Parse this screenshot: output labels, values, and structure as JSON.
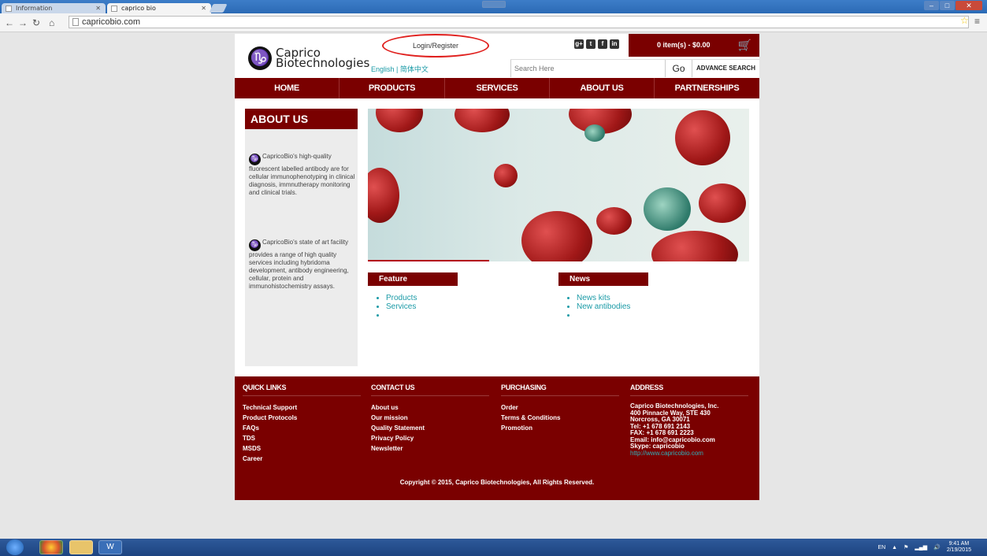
{
  "browser": {
    "tabs": [
      {
        "label": "Information",
        "active": false
      },
      {
        "label": "caprico bio",
        "active": true
      }
    ],
    "url": "capricobio.com"
  },
  "site": {
    "logo": {
      "line1": "Caprico",
      "line2": "Biotechnologies"
    },
    "login": "Login/Register",
    "language": "English | 简体中文",
    "social_icons": [
      "google-plus-icon",
      "twitter-icon",
      "facebook-icon",
      "linkedin-icon"
    ],
    "cart": "0 item(s) - $0.00",
    "search": {
      "placeholder": "Search Here",
      "go": "Go",
      "advanced": "ADVANCE SEARCH"
    },
    "nav": [
      "HOME",
      "PRODUCTS",
      "SERVICES",
      "ABOUT US",
      "PARTNERSHIPS"
    ],
    "about": {
      "title": "ABOUT US",
      "para1": "CapricoBio's high-quality fluorescent labelled antibody are for cellular immunophenotyping in clinical diagnosis, immnutherapy monitoring and clinical trials.",
      "para2": "CapricoBio's state of art facility provides a range of high quality services including hybridoma development, antibody engineering, cellular, protein and immunohistochemistry assays."
    },
    "feature": {
      "title": "Feature",
      "items": [
        "Products",
        "Services",
        ""
      ]
    },
    "news": {
      "title": "News",
      "items": [
        "News kits",
        "New antibodies",
        ""
      ]
    },
    "footer": {
      "quick_links": {
        "title": "QUICK LINKS",
        "items": [
          "Technical Support",
          "Product Protocols",
          "FAQs",
          "TDS",
          "MSDS",
          "Career"
        ]
      },
      "contact": {
        "title": "CONTACT US",
        "items": [
          "About us",
          "Our mission",
          "Quality Statement",
          "Privacy Policy",
          "Newsletter"
        ]
      },
      "purchasing": {
        "title": "PURCHASING",
        "items": [
          "Order",
          "Terms & Conditions",
          "Promotion"
        ]
      },
      "address": {
        "title": "ADDRESS",
        "lines": [
          "Caprico Biotechnologies, Inc.",
          "400 Pinnacle Way, STE 430",
          "Norcross, GA 30071",
          "Tel: +1 678 691 2143",
          "FAX: +1 678 691 2223",
          "Email: info@capricobio.com",
          "Skype: capricobio"
        ],
        "web": "http://www.capricobio.com"
      },
      "copyright": "Copyright © 2015, Caprico Biotechnologies, All Rights Reserved."
    }
  },
  "taskbar": {
    "lang": "EN",
    "time": "9:41 AM",
    "date": "2/19/2015"
  },
  "colors": {
    "brand": "#7a0000",
    "link": "#1a9aa6",
    "highlight_circle": "#e0201e"
  }
}
